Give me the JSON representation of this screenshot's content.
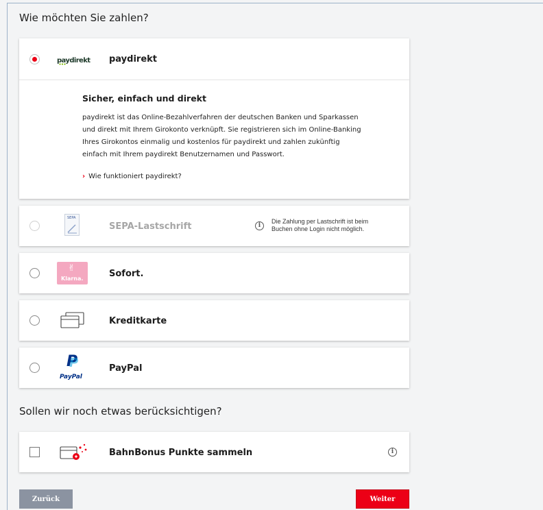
{
  "payment": {
    "heading": "Wie möchten Sie zahlen?",
    "options": [
      {
        "logo_text": "paydirekt",
        "label": "paydirekt",
        "selected": true,
        "details": {
          "title": "Sicher, einfach und direkt",
          "lines": [
            "paydirekt ist das Online-Bezahlverfahren der deutschen Banken und Sparkassen",
            "und direkt mit Ihrem Girokonto verknüpft. Sie registrieren sich im Online-Banking",
            "Ihres Girokontos einmalig und kostenlos für paydirekt und zahlen zukünftig",
            "einfach mit Ihrem paydirekt Benutzernamen und Passwort."
          ],
          "link": "Wie funktioniert paydirekt?"
        }
      },
      {
        "logo_text": "SEPA",
        "label": "SEPA-Lastschrift",
        "disabled": true,
        "note_lines": [
          "Die Zahlung per Lastschrift ist beim",
          "Buchen ohne Login nicht möglich."
        ]
      },
      {
        "logo_text": "Klarna.",
        "label": "Sofort."
      },
      {
        "label": "Kreditkarte"
      },
      {
        "logo_text": "PayPal",
        "label": "PayPal"
      }
    ]
  },
  "extras": {
    "heading": "Sollen wir noch etwas berücksichtigen?",
    "bahnbonus_label": "BahnBonus Punkte sammeln"
  },
  "buttons": {
    "back": "Zurück",
    "next": "Weiter"
  },
  "colors": {
    "accent_red": "#ec0016",
    "klarna_pink": "#f4a8c0",
    "paypal_dark": "#003087",
    "paypal_light": "#009cde",
    "back_button": "#8b93a1"
  },
  "icons": {
    "info": "info-icon",
    "card": "credit-card-icon",
    "bahnbonus": "bahnbonus-card-icon"
  }
}
